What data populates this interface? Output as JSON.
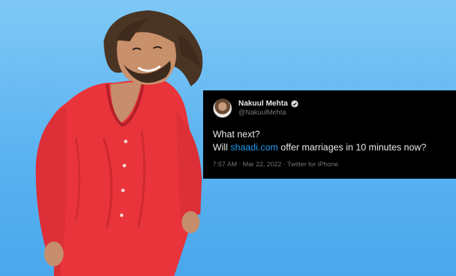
{
  "tweet": {
    "display_name": "Nakuul Mehta",
    "handle": "@NakuulMehta",
    "verified_icon": "verified-badge-icon",
    "line1": "What next?",
    "line2_prefix": "Will ",
    "link_text": "shaadi.com",
    "line2_suffix": " offer marriages in 10 minutes now?",
    "time": "7:57 AM",
    "date": "Mar 22, 2022",
    "source": "Twitter for iPhone",
    "separator": " · "
  },
  "colors": {
    "background": "#5bb3f0",
    "tweet_bg": "#000000",
    "link": "#1d9bf0",
    "shirt": "#e8343a"
  }
}
